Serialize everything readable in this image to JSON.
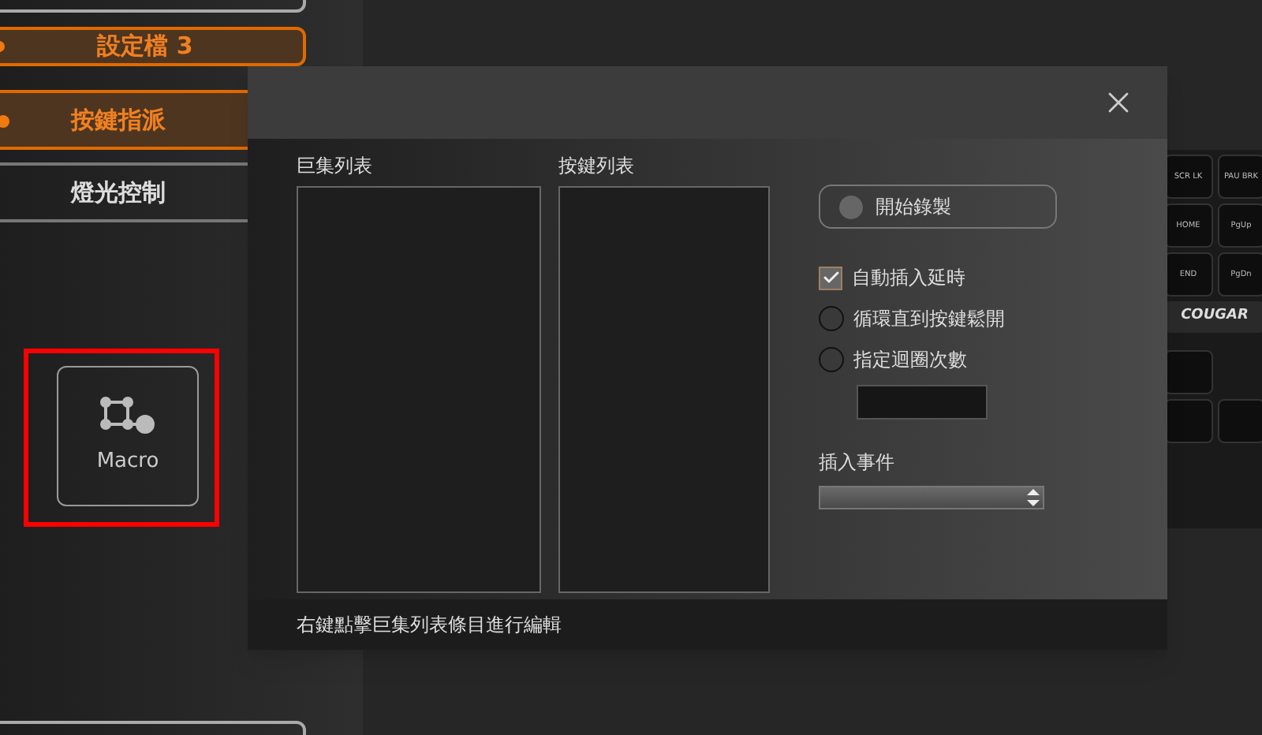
{
  "sidebar": {
    "profile_button": {
      "label": "設定檔 3",
      "selected": true
    },
    "menu": [
      {
        "label": "按鍵指派",
        "selected": true
      },
      {
        "label": "燈光控制",
        "selected": false
      }
    ],
    "macro_tile": {
      "label": "Macro",
      "highlighted": true
    }
  },
  "keyboard": {
    "keys": [
      {
        "label": "SCR LK"
      },
      {
        "label": "PAU BRK"
      },
      {
        "label": "HOME"
      },
      {
        "label": "PgUp"
      },
      {
        "label": "END"
      },
      {
        "label": "PgDn"
      }
    ],
    "logo": "COUGAR"
  },
  "dialog": {
    "macro_list": {
      "title": "巨集列表"
    },
    "key_list": {
      "title": "按鍵列表"
    },
    "record_button": {
      "label": "開始錄製"
    },
    "options": [
      {
        "kind": "checkbox",
        "label": "自動插入延時",
        "checked": true
      },
      {
        "kind": "radio",
        "label": "循環直到按鍵鬆開",
        "checked": false
      },
      {
        "kind": "radio",
        "label": "指定迴圈次數",
        "checked": false
      }
    ],
    "insert_event": {
      "label": "插入事件"
    },
    "hint": "右鍵點擊巨集列表條目進行編輯"
  }
}
